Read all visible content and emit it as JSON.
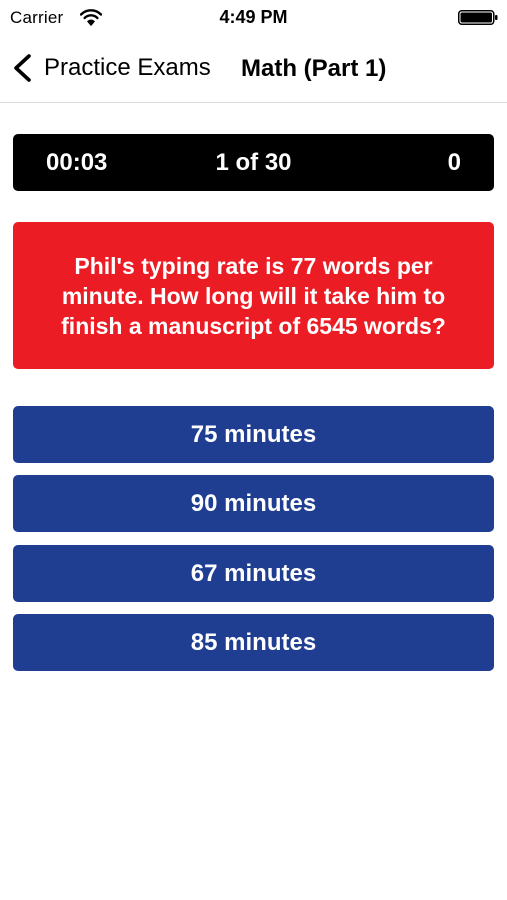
{
  "status_bar": {
    "carrier": "Carrier",
    "time": "4:49 PM",
    "wifi_icon": "wifi-icon",
    "battery_icon": "battery-icon"
  },
  "nav": {
    "back_label": "Practice Exams",
    "back_icon": "chevron-left-icon",
    "title": "Math (Part 1)"
  },
  "quiz": {
    "timer": "00:03",
    "progress": "1 of 30",
    "score": "0",
    "question": "Phil's typing rate is 77 words per minute. How long will it take him to finish a manuscript of 6545 words?",
    "answers": [
      {
        "label": "75 minutes"
      },
      {
        "label": "90 minutes"
      },
      {
        "label": "67 minutes"
      },
      {
        "label": "85 minutes"
      }
    ]
  },
  "colors": {
    "question_background": "#ec1c24",
    "answer_background": "#1f3e92",
    "score_bar_background": "#000000"
  }
}
